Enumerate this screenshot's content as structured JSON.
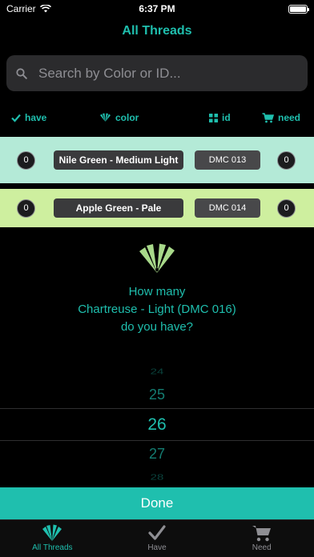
{
  "status": {
    "carrier": "Carrier",
    "time": "6:37 PM"
  },
  "header": {
    "title": "All Threads"
  },
  "search": {
    "placeholder": "Search by Color or ID..."
  },
  "filters": {
    "have": "have",
    "color": "color",
    "id": "id",
    "need": "need"
  },
  "threads": [
    {
      "have": "0",
      "name": "Nile Green - Medium Light",
      "id": "DMC 013",
      "need": "0",
      "color": "#b4ead7"
    },
    {
      "have": "0",
      "name": "Apple Green - Pale",
      "id": "DMC 014",
      "need": "0",
      "color": "#ceef9f"
    }
  ],
  "prompt": {
    "line1": "How many",
    "line2": "Chartreuse - Light (DMC 016)",
    "line3": "do you have?"
  },
  "picker": {
    "values": [
      "24",
      "25",
      "26",
      "27",
      "28"
    ],
    "selected": "26"
  },
  "done_label": "Done",
  "tabs": [
    {
      "label": "All Threads",
      "icon": "fan-icon",
      "active": true
    },
    {
      "label": "Have",
      "icon": "checkmark-icon",
      "active": false
    },
    {
      "label": "Need",
      "icon": "cart-icon",
      "active": false
    }
  ],
  "colors": {
    "accent": "#1fbfae",
    "background": "#000000"
  }
}
